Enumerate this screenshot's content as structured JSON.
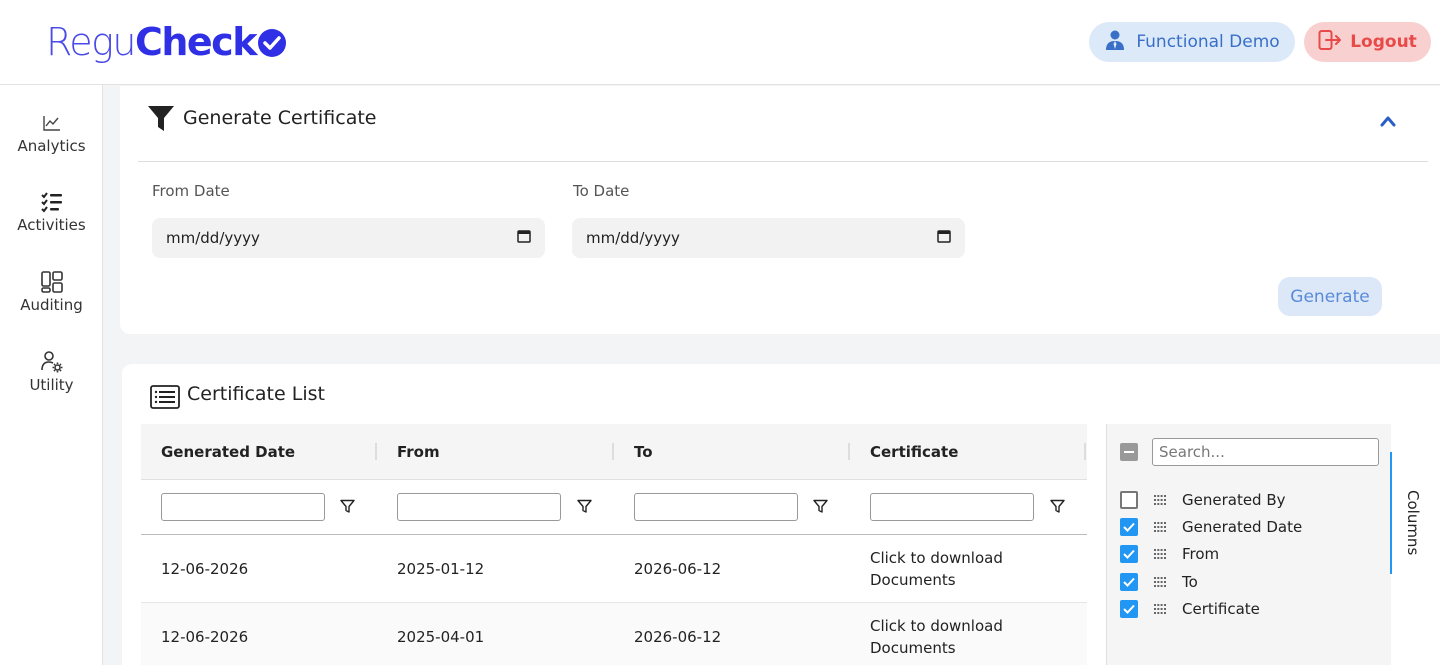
{
  "header": {
    "logo_regu": "Regu",
    "logo_check": "Check",
    "demo_label": "Functional Demo",
    "logout_label": "Logout"
  },
  "sidebar": {
    "items": [
      {
        "label": "Analytics",
        "icon": "chart-line-icon"
      },
      {
        "label": "Activities",
        "icon": "checklist-icon"
      },
      {
        "label": "Auditing",
        "icon": "dashboard-icon"
      },
      {
        "label": "Utility",
        "icon": "user-gear-icon"
      }
    ]
  },
  "generate": {
    "title": "Generate Certificate",
    "from_label": "From Date",
    "to_label": "To Date",
    "from_placeholder": "mm/dd/yyyy",
    "to_placeholder": "mm/dd/yyyy",
    "button": "Generate"
  },
  "list": {
    "title": "Certificate List",
    "columns": [
      "Generated Date",
      "From",
      "To",
      "Certificate"
    ],
    "rows": [
      {
        "generated": "12-06-2026",
        "from": "2025-01-12",
        "to": "2026-06-12",
        "cert_line1": "Click to download",
        "cert_line2": "Documents"
      },
      {
        "generated": "12-06-2026",
        "from": "2025-04-01",
        "to": "2026-06-12",
        "cert_line1": "Click to download",
        "cert_line2": "Documents"
      }
    ]
  },
  "columns_panel": {
    "search_placeholder": "Search...",
    "tab_label": "Columns",
    "items": [
      {
        "label": "Generated By",
        "checked": false
      },
      {
        "label": "Generated Date",
        "checked": true
      },
      {
        "label": "From",
        "checked": true
      },
      {
        "label": "To",
        "checked": true
      },
      {
        "label": "Certificate",
        "checked": true
      }
    ]
  },
  "colors": {
    "brand": "#2f2fe6",
    "demo_bg": "#dbe9f9",
    "logout_bg": "#f9d0d0",
    "checkbox": "#2196f3"
  }
}
